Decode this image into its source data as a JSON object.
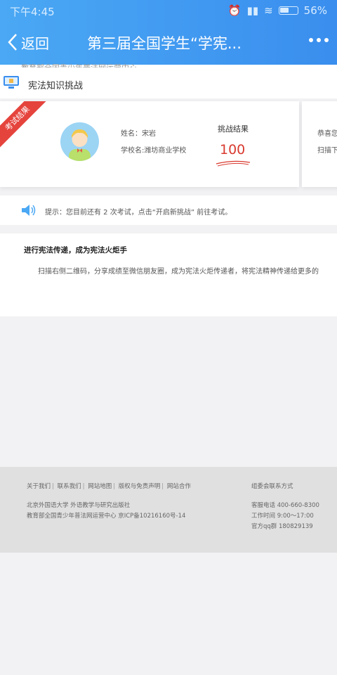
{
  "status_bar": {
    "time": "下午4:45",
    "battery": "56%"
  },
  "nav": {
    "back_label": "返回",
    "title": "第三届全国学生“学宪..."
  },
  "section": {
    "cropped_text": "教育部全国青少年普法网运营中心",
    "title": "宪法知识挑战"
  },
  "result": {
    "ribbon": "考试结果",
    "name": "姓名：宋岩",
    "school": "学校名:潍坊商业学校",
    "score_label": "挑战结果",
    "score": "100"
  },
  "card2": {
    "line1": "恭喜您",
    "line2": "扫描下"
  },
  "tip": {
    "text": "提示：您目前还有 2 次考试，点击“开启新挑战” 前往考试。"
  },
  "pass": {
    "title": "进行宪法传递，成为宪法火炬手",
    "text": "扫描右侧二维码，分享成绩至微信朋友圈，成为宪法火炬传递者，将宪法精神传递给更多的"
  },
  "footer": {
    "links": [
      "关于我们",
      "联系我们",
      "网站地图",
      "版权与免责声明",
      "网站合作"
    ],
    "publisher": "北京外国语大学 外语教学与研究出版社",
    "icp": "教育部全国青少年普法网运营中心 京ICP备10216160号-14",
    "contact_title": "组委会联系方式",
    "hotline": "客服电话 400-660-8300",
    "hours": "工作时间 9:00～17:00",
    "qq": "官方qq群 180829139"
  },
  "colors": {
    "header": "#3a8eee",
    "score": "#d93a2f",
    "ribbon": "#e5443d"
  }
}
